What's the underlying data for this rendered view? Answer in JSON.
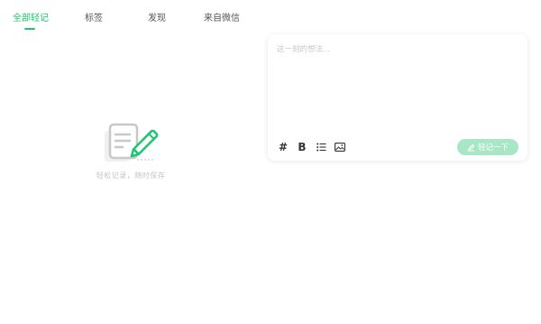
{
  "tabs": [
    {
      "label": "全部轻记",
      "active": true
    },
    {
      "label": "标签",
      "active": false
    },
    {
      "label": "发现",
      "active": false
    },
    {
      "label": "来自微信",
      "active": false
    }
  ],
  "empty_state": {
    "icon": "note-edit-icon",
    "text": "轻松记录，随时保存"
  },
  "editor": {
    "placeholder": "这一刻的想法...",
    "value": "",
    "toolbar": {
      "hash": "#",
      "bold": "B",
      "list_icon": "bullet-list-icon",
      "image_icon": "image-icon"
    },
    "submit_label": "轻记一下",
    "submit_icon": "pencil-icon"
  },
  "colors": {
    "accent": "#1cc66f",
    "submit_disabled": "#a8e7c6"
  }
}
